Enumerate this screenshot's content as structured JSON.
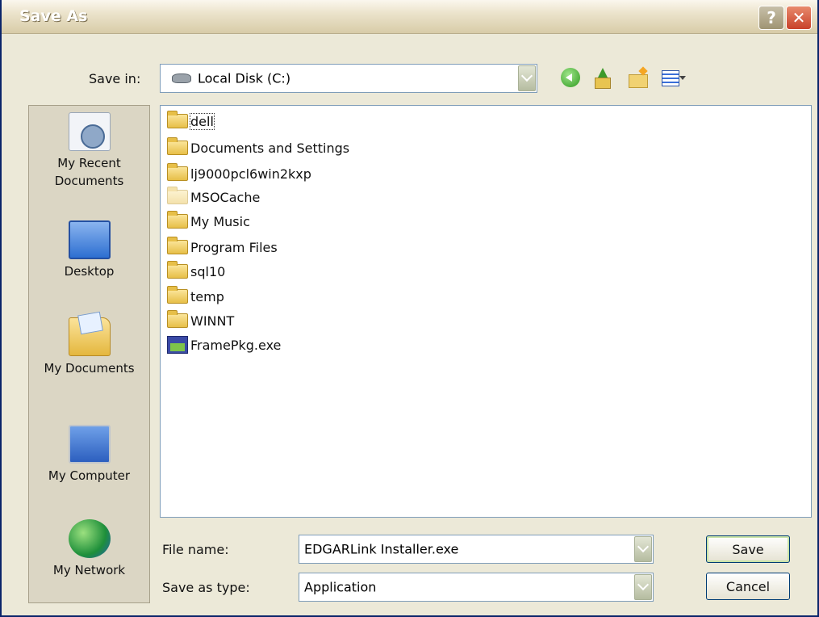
{
  "window": {
    "title": "Save As",
    "help_label": "?",
    "close_label": "✕"
  },
  "save_in": {
    "label": "Save in:",
    "value": "Local Disk (C:)"
  },
  "toolbar": {
    "icons": [
      "back-icon",
      "up-one-level-icon",
      "new-folder-icon",
      "views-menu-icon"
    ]
  },
  "places": [
    {
      "label": "My Recent Documents",
      "icon": "recent-documents-icon"
    },
    {
      "label": "Desktop",
      "icon": "desktop-icon"
    },
    {
      "label": "My Documents",
      "icon": "my-documents-icon"
    },
    {
      "label": "My Computer",
      "icon": "my-computer-icon"
    },
    {
      "label": "My Network",
      "icon": "my-network-icon"
    }
  ],
  "files": [
    {
      "name": "dell",
      "type": "folder"
    },
    {
      "name": "Documents and Settings",
      "type": "folder"
    },
    {
      "name": "lj9000pcl6win2kxp",
      "type": "folder"
    },
    {
      "name": "MSOCache",
      "type": "folder-hidden"
    },
    {
      "name": "My Music",
      "type": "folder"
    },
    {
      "name": "Program Files",
      "type": "folder"
    },
    {
      "name": "sql10",
      "type": "folder"
    },
    {
      "name": "temp",
      "type": "folder"
    },
    {
      "name": "WINNT",
      "type": "folder"
    },
    {
      "name": "FramePkg.exe",
      "type": "application"
    }
  ],
  "file_name": {
    "label": "File name:",
    "value": "EDGARLink Installer.exe"
  },
  "save_as_type": {
    "label": "Save as type:",
    "value": "Application"
  },
  "buttons": {
    "save": "Save",
    "cancel": "Cancel"
  },
  "colors": {
    "dialog_bg": "#ece9d8",
    "field_border": "#7f9db9",
    "button_border": "#003c74"
  }
}
